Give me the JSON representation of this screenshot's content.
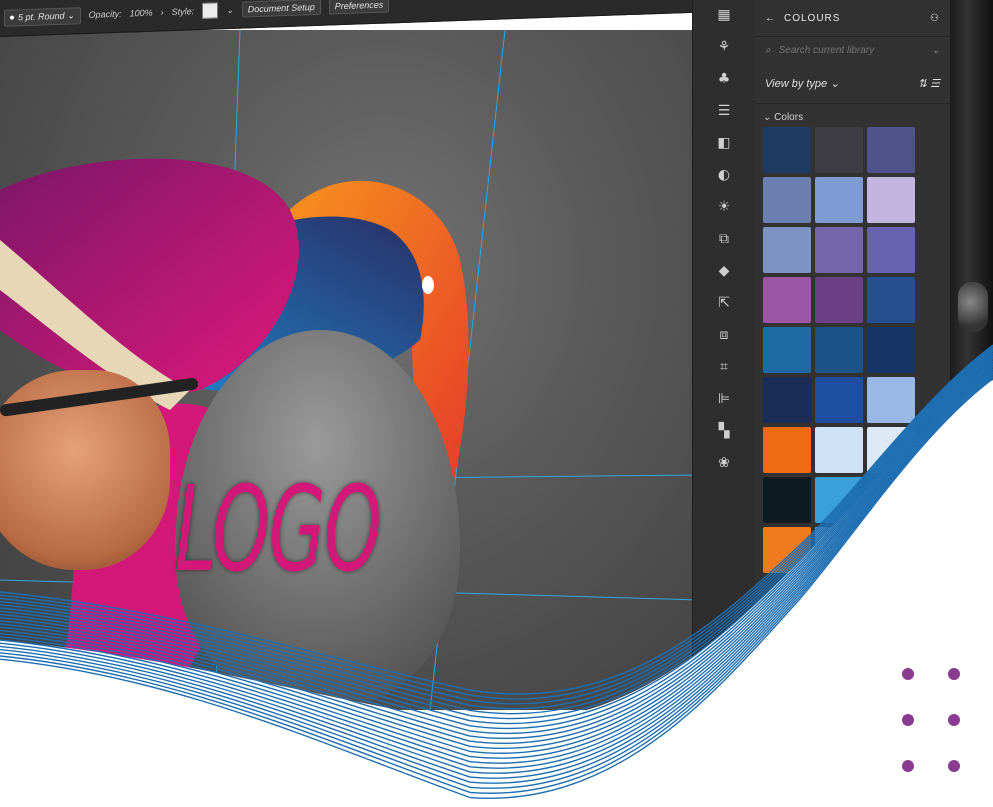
{
  "toolbar": {
    "stroke_value": "5 pt. Round",
    "opacity_label": "Opacity:",
    "opacity_value": "100%",
    "style_label": "Style:",
    "document_setup_button": "Document Setup",
    "preferences_button": "Preferences"
  },
  "artwork": {
    "logo_text": "LOGO"
  },
  "panel": {
    "back_label": "←",
    "title": "COLOURS",
    "search_placeholder": "Search current library",
    "view_by_label": "View by type",
    "section_label": "Colors",
    "swatches": [
      "#1f3a63",
      "#3f3d44",
      "#4f528b",
      "#6b7fb0",
      "#7e9bd4",
      "#c2b6e0",
      "#7c93c4",
      "#7566a9",
      "#6863b0",
      "#9d55a6",
      "#6b3f86",
      "#264f92",
      "#1e6aa3",
      "#1c5286",
      "#163566",
      "#1a2d57",
      "#1d4ea0",
      "#9ab8e5",
      "#f06a14",
      "#cfe2f7",
      "#dde9f4",
      "#0c1a22",
      "#3aa0d9",
      "#3aa8a6",
      "#ef7a1f",
      "#bcd3ee",
      "#e0e0e0"
    ]
  },
  "colors": {
    "wave": "#1e6fb2",
    "dots": "#8a3a8f",
    "guide": "#2ea7e6",
    "pink": "#d4187a",
    "orange": "#f2801c"
  }
}
